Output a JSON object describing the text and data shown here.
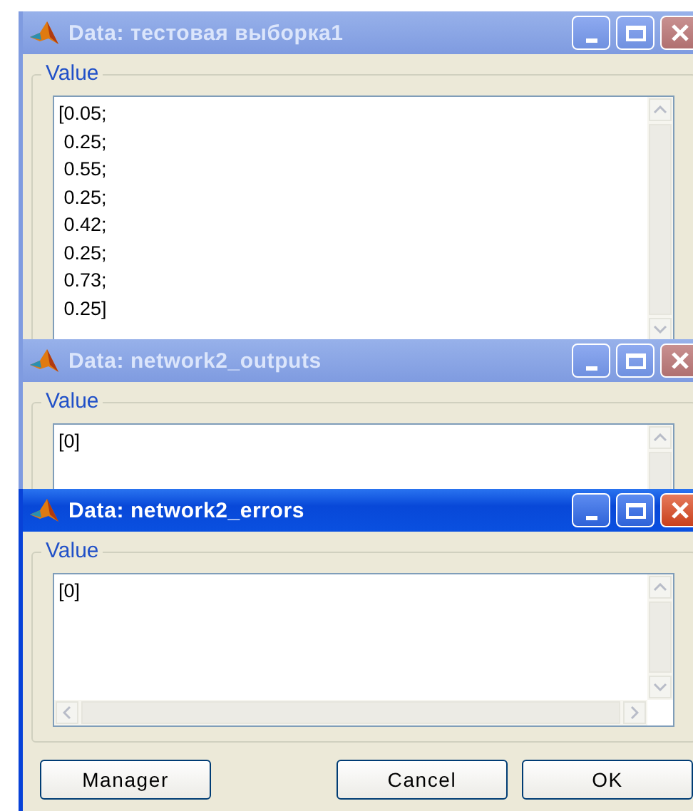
{
  "windows": [
    {
      "title": "Data: тестовая выборка1",
      "active": false,
      "value_label": "Value",
      "lines": [
        "[0.05;",
        " 0.25;",
        " 0.55;",
        " 0.25;",
        " 0.42;",
        " 0.25;",
        " 0.73;",
        " 0.25]"
      ]
    },
    {
      "title": "Data: network2_outputs",
      "active": false,
      "value_label": "Value",
      "lines": [
        "[0]"
      ]
    },
    {
      "title": "Data: network2_errors",
      "active": true,
      "value_label": "Value",
      "lines": [
        "[0]"
      ],
      "buttons": [
        "Manager",
        "Cancel",
        "OK"
      ]
    }
  ]
}
